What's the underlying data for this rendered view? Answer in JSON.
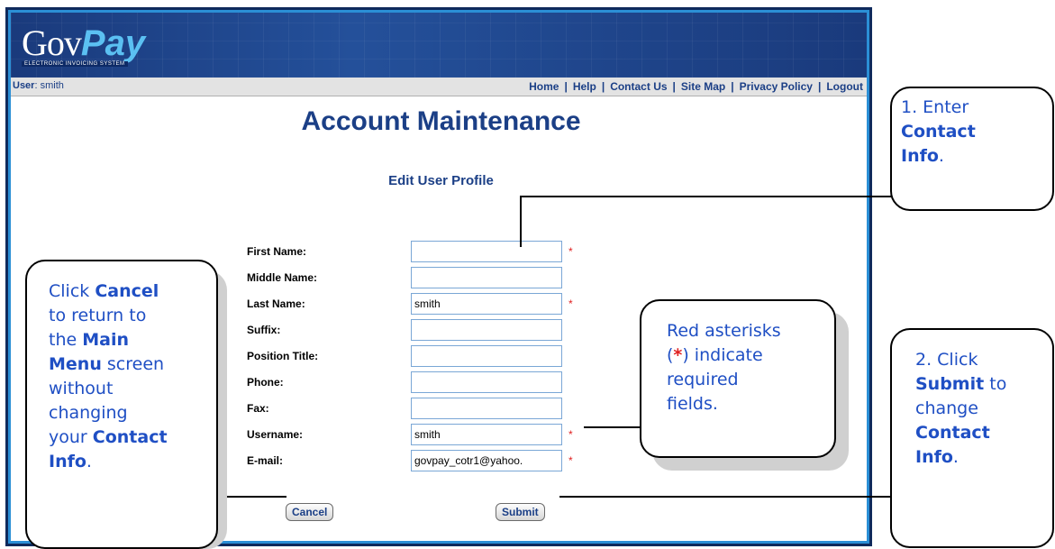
{
  "header": {
    "logo_gov": "Gov",
    "logo_pay": "Pay",
    "logo_tagline": "ELECTRONIC INVOICING SYSTEM",
    "user_label": "User",
    "user_name": ": smith",
    "nav": [
      "Home",
      "Help",
      "Contact Us",
      "Site Map",
      "Privacy Policy",
      "Logout"
    ],
    "nav_sep": "|"
  },
  "page": {
    "title": "Account Maintenance",
    "section_title": "Edit User Profile"
  },
  "form": {
    "fields": [
      {
        "label": "First Name:",
        "value": "",
        "required": true
      },
      {
        "label": "Middle Name:",
        "value": "",
        "required": false
      },
      {
        "label": "Last Name:",
        "value": "smith",
        "required": true
      },
      {
        "label": "Suffix:",
        "value": "",
        "required": false
      },
      {
        "label": "Position Title:",
        "value": "",
        "required": false
      },
      {
        "label": "Phone:",
        "value": "",
        "required": false
      },
      {
        "label": "Fax:",
        "value": "",
        "required": false
      },
      {
        "label": "Username:",
        "value": "smith",
        "required": true
      },
      {
        "label": "E-mail:",
        "value": "govpay_cotr1@yahoo.",
        "required": true
      }
    ],
    "required_mark": "*",
    "cancel_label": "Cancel",
    "submit_label": "Submit"
  },
  "callouts": {
    "enter_info": {
      "line1": "1. Enter",
      "bold1": "Contact",
      "bold2": "Info",
      "end": "."
    },
    "cancel": {
      "t1": "Click ",
      "b1": "Cancel",
      "t2": "to return to",
      "t3": "the ",
      "b2": "Main",
      "b3": "Menu",
      "t4": " screen",
      "t5": "without",
      "t6": "changing",
      "t7": "your ",
      "b4": "Contact",
      "b5": "Info",
      "t8": "."
    },
    "asterisk": {
      "t1": "Red asterisks",
      "p1": "(",
      "star": "*",
      "p2": ") indicate",
      "t2": "required",
      "t3": "fields."
    },
    "submit": {
      "t1": "2. Click",
      "b1": "Submit",
      "t2": " to",
      "t3": "change",
      "b2": "Contact",
      "b3": "Info",
      "t4": "."
    }
  },
  "colors": {
    "callout_text": "#1f4fc4",
    "required": "#e02020",
    "brand": "#1b3f86",
    "frame": "#0f2a5c",
    "frame_accent": "#2b8fd6"
  }
}
